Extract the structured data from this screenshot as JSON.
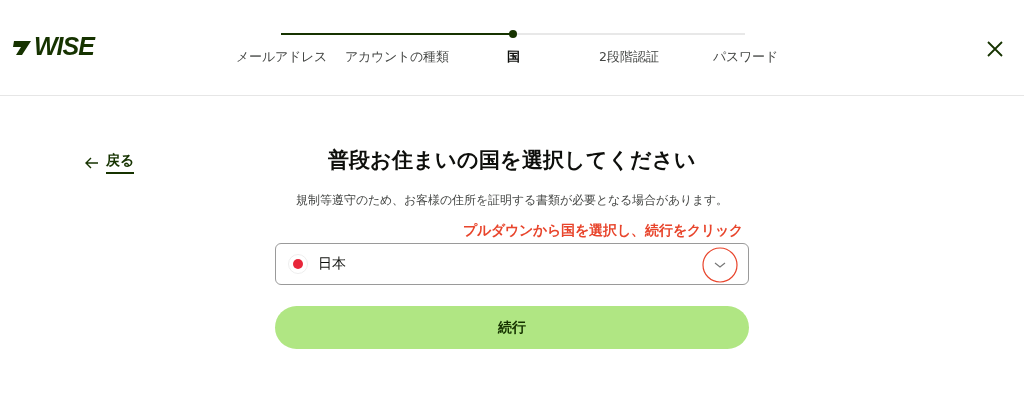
{
  "header": {
    "logo": "WISE",
    "steps": [
      {
        "label": "メールアドレス",
        "selected": false
      },
      {
        "label": "アカウントの種類",
        "selected": false
      },
      {
        "label": "国",
        "selected": true
      },
      {
        "label": "2段階認証",
        "selected": false
      },
      {
        "label": "パスワード",
        "selected": false
      }
    ]
  },
  "back_link": "戻る",
  "title": "普段お住まいの国を選択してください",
  "subtitle": "規制等遵守のため、お客様の住所を証明する書類が必要となる場合があります。",
  "annotation": "プルダウンから国を選択し、続行をクリック",
  "country_select": {
    "value": "日本"
  },
  "continue_button": "続行"
}
